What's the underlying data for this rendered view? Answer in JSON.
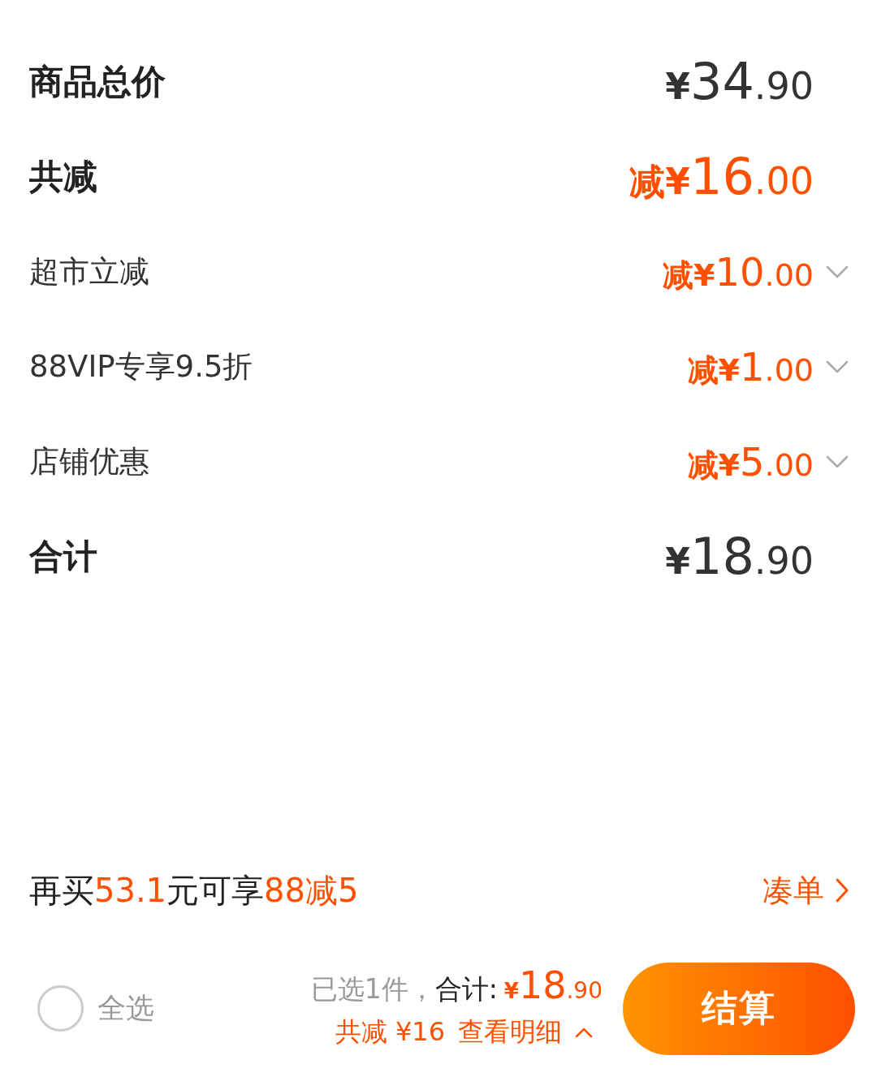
{
  "summary": {
    "subtotal": {
      "label": "商品总价",
      "amount": {
        "prefix": "¥",
        "integer": "34",
        "fraction": ".90"
      }
    },
    "reduction": {
      "label": "共减",
      "amount": {
        "prefix": "减¥",
        "integer": "16",
        "fraction": ".00"
      }
    },
    "discounts": [
      {
        "label": "超市立减",
        "amount": {
          "prefix": "减¥",
          "integer": "10",
          "fraction": ".00"
        },
        "expanded": false
      },
      {
        "label": "88VIP专享9.5折",
        "amount": {
          "prefix": "减¥",
          "integer": "1",
          "fraction": ".00"
        },
        "expanded": false
      },
      {
        "label": "店铺优惠",
        "amount": {
          "prefix": "减¥",
          "integer": "5",
          "fraction": ".00"
        },
        "expanded": false
      }
    ],
    "total": {
      "label": "合计",
      "amount": {
        "prefix": "¥",
        "integer": "18",
        "fraction": ".90"
      }
    }
  },
  "promo": {
    "message": [
      {
        "text": "再买",
        "highlight": false
      },
      {
        "text": "53.1",
        "highlight": true
      },
      {
        "text": "元可享",
        "highlight": false
      },
      {
        "text": "88减5",
        "highlight": true
      }
    ],
    "link": "凑单"
  },
  "footer": {
    "select_all": {
      "label": "全选",
      "checked": false
    },
    "selected_count": "已选1件，",
    "total_label": "合计:",
    "total": {
      "prefix": "¥",
      "integer": "18",
      "fraction": ".90"
    },
    "savings": "共减 ¥16",
    "details_link": "查看明细",
    "checkout": "结算"
  }
}
